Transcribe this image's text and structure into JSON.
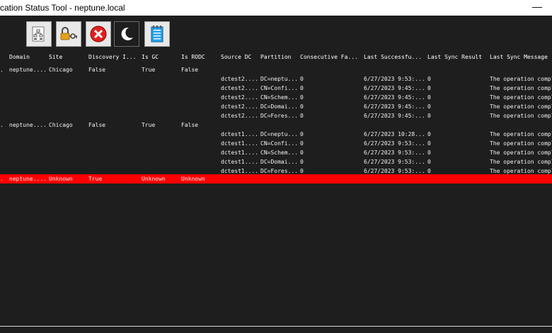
{
  "window": {
    "title": "cation Status Tool - neptune.local",
    "minimize_glyph": "—"
  },
  "toolbar": {
    "buttons": [
      {
        "name": "network-report-icon"
      },
      {
        "name": "key-lock-icon"
      },
      {
        "name": "close-x-icon"
      },
      {
        "name": "moon-icon"
      },
      {
        "name": "notepad-icon"
      }
    ]
  },
  "grid": {
    "columns": [
      "",
      "Domain",
      "Site",
      "Discovery I...",
      "Is GC",
      "Is RODC",
      "Source DC",
      "Partition",
      "Consecutive Fa...",
      "Last Successfu...",
      "Last Sync Result",
      "Last Sync Message"
    ],
    "rows": [
      {
        "type": "dc",
        "cells": [
          ".",
          "neptune....",
          "Chicago",
          "False",
          "True",
          "False",
          "",
          "",
          "",
          "",
          "",
          ""
        ]
      },
      {
        "type": "sub",
        "cells": [
          "",
          "",
          "",
          "",
          "",
          "",
          "dctest2....",
          "DC=neptu...",
          "0",
          "6/27/2023 9:53:...",
          "0",
          "The operation comple"
        ]
      },
      {
        "type": "sub",
        "cells": [
          "",
          "",
          "",
          "",
          "",
          "",
          "dctest2....",
          "CN=Confi...",
          "0",
          "6/27/2023 9:45:...",
          "0",
          "The operation comple"
        ]
      },
      {
        "type": "sub",
        "cells": [
          "",
          "",
          "",
          "",
          "",
          "",
          "dctest2....",
          "CN=Schem...",
          "0",
          "6/27/2023 9:45:...",
          "0",
          "The operation comple"
        ]
      },
      {
        "type": "sub",
        "cells": [
          "",
          "",
          "",
          "",
          "",
          "",
          "dctest2....",
          "DC=Domai...",
          "0",
          "6/27/2023 9:45:...",
          "0",
          "The operation comple"
        ]
      },
      {
        "type": "sub",
        "cells": [
          "",
          "",
          "",
          "",
          "",
          "",
          "dctest2....",
          "DC=Fores...",
          "0",
          "6/27/2023 9:45:...",
          "0",
          "The operation comple"
        ]
      },
      {
        "type": "dc",
        "cells": [
          ".",
          "neptune....",
          "Chicago",
          "False",
          "True",
          "False",
          "",
          "",
          "",
          "",
          "",
          ""
        ]
      },
      {
        "type": "sub",
        "cells": [
          "",
          "",
          "",
          "",
          "",
          "",
          "dctest1....",
          "DC=neptu...",
          "0",
          "6/27/2023 10:28...",
          "0",
          "The operation comple"
        ]
      },
      {
        "type": "sub",
        "cells": [
          "",
          "",
          "",
          "",
          "",
          "",
          "dctest1....",
          "CN=Confi...",
          "0",
          "6/27/2023 9:53:...",
          "0",
          "The operation comple"
        ]
      },
      {
        "type": "sub",
        "cells": [
          "",
          "",
          "",
          "",
          "",
          "",
          "dctest1....",
          "CN=Schem...",
          "0",
          "6/27/2023 9:53:...",
          "0",
          "The operation comple"
        ]
      },
      {
        "type": "sub",
        "cells": [
          "",
          "",
          "",
          "",
          "",
          "",
          "dctest1....",
          "DC=Domai...",
          "0",
          "6/27/2023 9:53:...",
          "0",
          "The operation comple"
        ]
      },
      {
        "type": "sub",
        "cells": [
          "",
          "",
          "",
          "",
          "",
          "",
          "dctest1....",
          "DC=Fores...",
          "0",
          "6/27/2023 9:53:...",
          "0",
          "The operation comple"
        ]
      },
      {
        "type": "err",
        "cells": [
          ".",
          "neptune....",
          "Unknown",
          "True",
          "Unknown",
          "Unknown",
          "",
          "",
          "",
          "",
          "",
          ""
        ]
      }
    ]
  },
  "colors": {
    "background": "#1e1e1e",
    "text": "#f0f0f0",
    "error_row": "#ff0000"
  }
}
